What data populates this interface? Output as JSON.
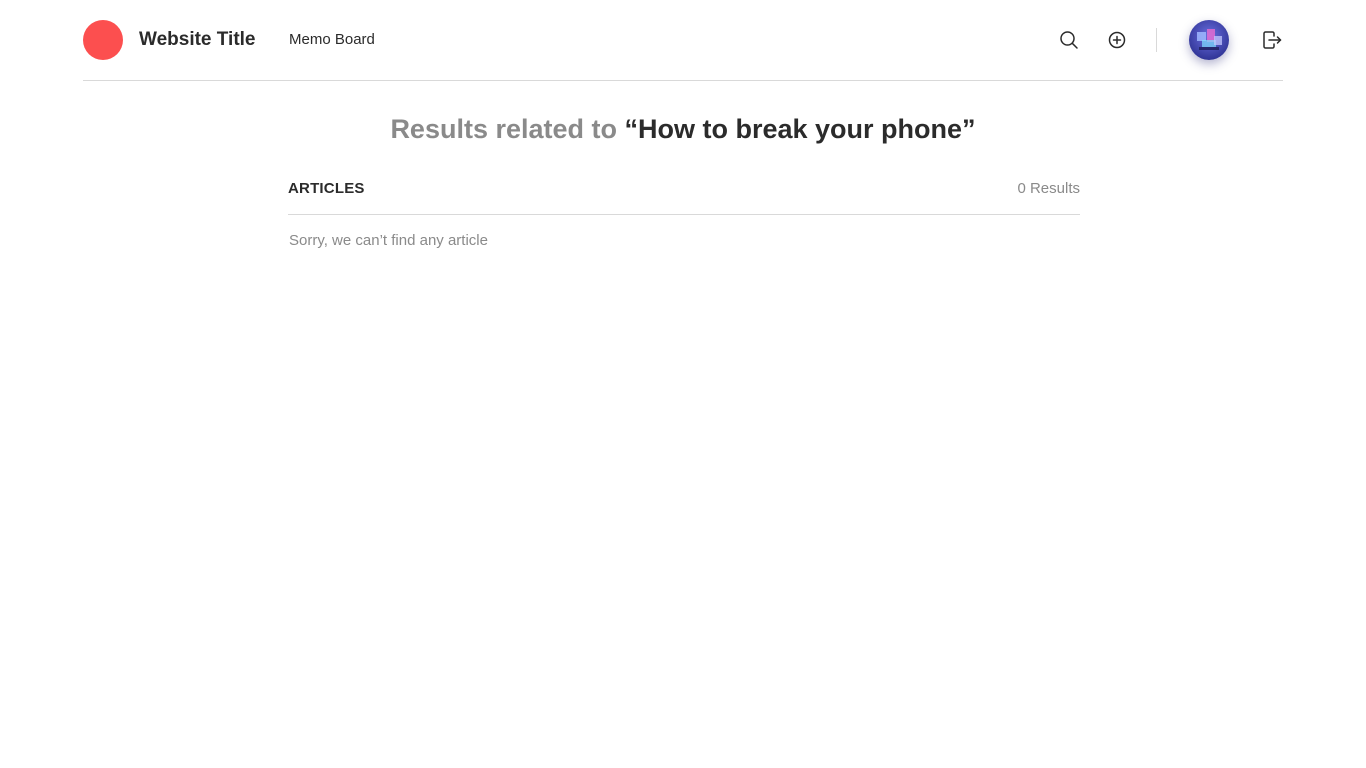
{
  "header": {
    "site_title": "Website Title",
    "nav": [
      {
        "label": "Memo Board"
      }
    ],
    "icons": {
      "search": "search-icon",
      "add": "plus-circle-icon",
      "logout": "logout-icon"
    },
    "logo_color": "#fc4f4f"
  },
  "search": {
    "heading_prefix": "Results related to",
    "query_display": "“How to break your phone”"
  },
  "articles": {
    "section_title": "ARTICLES",
    "results_count": "0 Results",
    "empty_message": "Sorry, we can’t find any article"
  },
  "colors": {
    "text_primary": "#2b2b2b",
    "text_muted": "#8a8a8a",
    "divider": "#d9d9d9",
    "accent": "#fc4f4f"
  }
}
